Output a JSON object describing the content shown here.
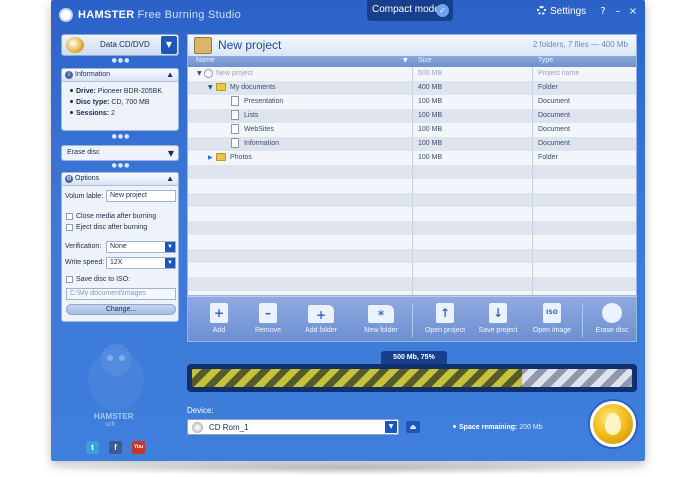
{
  "app": {
    "brand": "HAMSTER",
    "brand_sub": "Free Burning Studio",
    "compact_mode_label": "Compact mode",
    "settings_label": "Settings",
    "window_controls": {
      "help": "?",
      "minimize": "–",
      "close": "×"
    }
  },
  "sidebar": {
    "mode_dropdown": "Data CD/DVD",
    "information": {
      "title": "Information",
      "drive_label": "Drive:",
      "drive_value": "Pioneer BDR-205BK",
      "disc_type_label": "Disc type:",
      "disc_type_value": "CD, 700 MB",
      "sessions_label": "Sessions:",
      "sessions_value": "2"
    },
    "erase_disc": "Erase disc",
    "options": {
      "title": "Options",
      "volume_label_label": "Volum lable:",
      "volume_label_value": "New project",
      "close_media": "Close media after burning",
      "eject_disc": "Eject disc after burning",
      "verification_label": "Verification:",
      "verification_value": "None",
      "write_speed_label": "Write speed:",
      "write_speed_value": "12X",
      "save_iso": "Save disc to ISO:",
      "iso_path": "C:\\My document\\Images",
      "change_button": "Change..."
    },
    "mascot_text_1": "HAMSTER",
    "mascot_text_2": "soft",
    "social": {
      "twitter": "t",
      "facebook": "f",
      "youtube": "You"
    }
  },
  "project": {
    "title": "New project",
    "summary": "2 folders, 7 files — 400 Mb"
  },
  "table": {
    "columns": [
      "Name",
      "Size",
      "Type"
    ],
    "rows": [
      {
        "name": "New project",
        "size": "500 MB",
        "type": "Project name",
        "muted": true
      },
      {
        "name": "My documents",
        "size": "400 MB",
        "type": "Folder"
      },
      {
        "name": "Presentation",
        "size": "100 MB",
        "type": "Document"
      },
      {
        "name": "Lists",
        "size": "100 MB",
        "type": "Document"
      },
      {
        "name": "WebSites",
        "size": "100 MB",
        "type": "Document"
      },
      {
        "name": "Information",
        "size": "100 MB",
        "type": "Document"
      },
      {
        "name": "Photos",
        "size": "100 MB",
        "type": "Folder"
      }
    ]
  },
  "toolbar": {
    "add": "Add",
    "remove": "Remove",
    "add_folder": "Add folder",
    "new_folder": "New folder",
    "open_project": "Open project",
    "save_project": "Save project",
    "open_image": "Open image",
    "erase_disc": "Erase disc",
    "icons": {
      "add": "+",
      "remove": "–",
      "add_folder": "+",
      "new_folder": "*",
      "open_project": "↑",
      "save_project": "↓",
      "open_image": "ISO"
    }
  },
  "progress": {
    "label": "500 Mb, 75%",
    "percent": 75
  },
  "device": {
    "label": "Device:",
    "selected": "CD Rom_1",
    "space_label": "Space remaining:",
    "space_value": "200 Mb"
  },
  "colors": {
    "window_blue": "#3c78d8",
    "accent_dark": "#173f8c",
    "burn_gold": "#f0c020"
  }
}
